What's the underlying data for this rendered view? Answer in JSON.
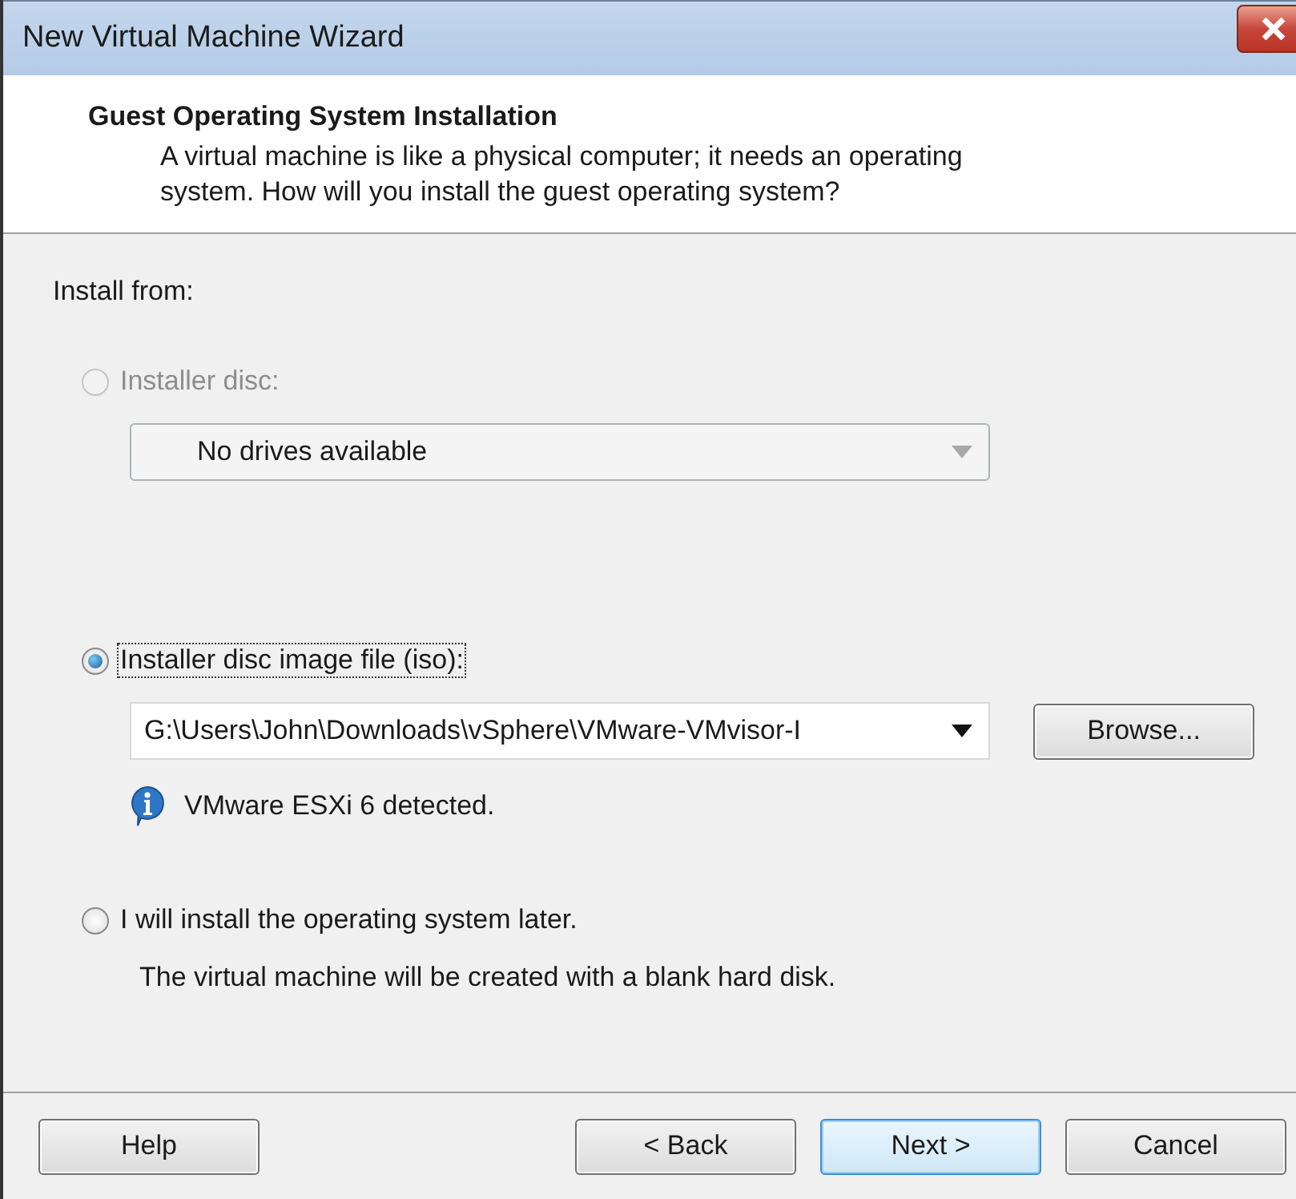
{
  "window": {
    "title": "New Virtual Machine Wizard"
  },
  "header": {
    "title": "Guest Operating System Installation",
    "description": "A virtual machine is like a physical computer; it needs an operating system. How will you install the guest operating system?"
  },
  "section_label": "Install from:",
  "options": [
    {
      "kind": "dropdown",
      "label": "Installer disc:",
      "selected": false,
      "disabled": true,
      "value": "No drives available"
    },
    {
      "kind": "file",
      "label": "Installer disc image file (iso):",
      "selected": true,
      "disabled": false,
      "value": "G:\\Users\\John\\Downloads\\vSphere\\VMware-VMvisor-I",
      "button": {
        "label": "Browse..."
      },
      "info": "VMware ESXi 6 detected."
    },
    {
      "kind": "later",
      "label": "I will install the operating system later.",
      "selected": false,
      "disabled": false,
      "note": "The virtual machine will be created with a blank hard disk."
    }
  ],
  "buttons": [
    {
      "label": "Help",
      "default": false
    },
    {
      "label": "< Back",
      "default": false
    },
    {
      "label": "Next >",
      "default": true
    },
    {
      "label": "Cancel",
      "default": false
    }
  ]
}
